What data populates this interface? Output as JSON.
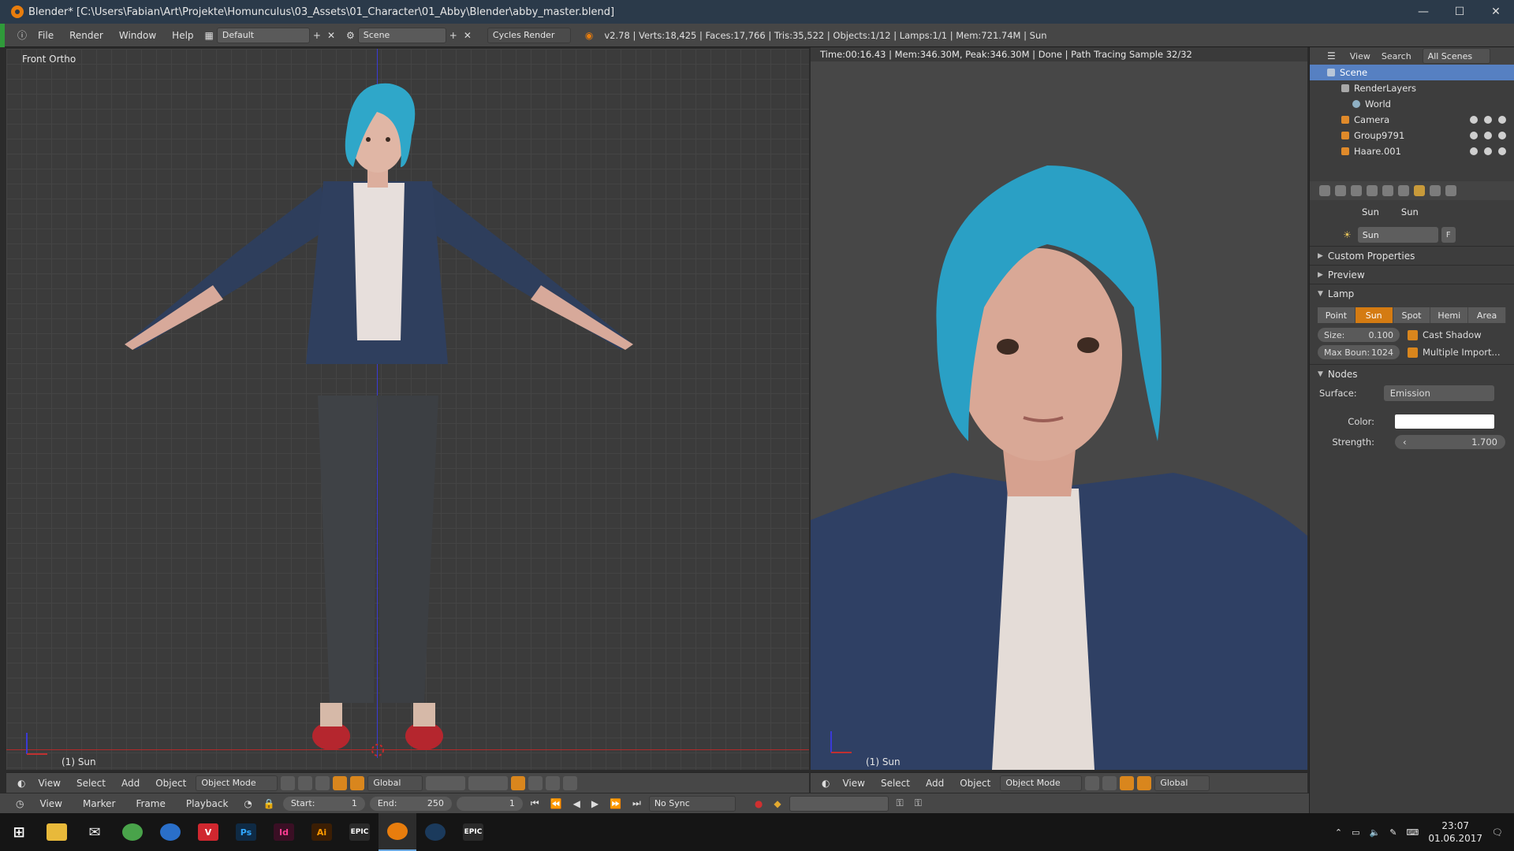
{
  "window": {
    "title": "Blender* [C:\\Users\\Fabian\\Art\\Projekte\\Homunculus\\03_Assets\\01_Character\\01_Abby\\Blender\\abby_master.blend]",
    "minimize": "—",
    "maximize": "☐",
    "close": "✕"
  },
  "infobar": {
    "menus": [
      "File",
      "Render",
      "Window",
      "Help"
    ],
    "layout": "Default",
    "scene": "Scene",
    "engine": "Cycles Render",
    "stats": "v2.78 | Verts:18,425 | Faces:17,766 | Tris:35,522 | Objects:1/12 | Lamps:1/1 | Mem:721.74M | Sun"
  },
  "viewport_left": {
    "view_label": "Front Ortho",
    "object_label": "(1) Sun",
    "header": {
      "menus": [
        "View",
        "Select",
        "Add",
        "Object"
      ],
      "mode": "Object Mode",
      "orientation": "Global"
    }
  },
  "viewport_right": {
    "render_status": "Time:00:16.43 | Mem:346.30M, Peak:346.30M | Done | Path Tracing Sample 32/32",
    "object_label": "(1) Sun",
    "header": {
      "menus": [
        "View",
        "Select",
        "Add",
        "Object"
      ],
      "mode": "Object Mode",
      "orientation": "Global"
    }
  },
  "timeline": {
    "menus": [
      "View",
      "Marker",
      "Frame",
      "Playback"
    ],
    "start_label": "Start:",
    "start": "1",
    "end_label": "End:",
    "end": "250",
    "current": "1",
    "sync": "No Sync"
  },
  "outliner": {
    "header": [
      "View",
      "Search",
      "All Scenes"
    ],
    "rows": [
      {
        "label": "Scene",
        "selected": true
      },
      {
        "label": "RenderLayers",
        "selected": false
      },
      {
        "label": "World",
        "selected": false
      },
      {
        "label": "Camera",
        "selected": false
      },
      {
        "label": "Group9791",
        "selected": false
      },
      {
        "label": "Haare.001",
        "selected": false
      }
    ]
  },
  "properties": {
    "breadcrumb": [
      "Sun",
      "Sun"
    ],
    "name": "Sun",
    "fake_user": "F",
    "panels": {
      "custom_properties": "Custom Properties",
      "preview": "Preview",
      "lamp": "Lamp",
      "nodes": "Nodes"
    },
    "lamp_types": [
      "Point",
      "Sun",
      "Spot",
      "Hemi",
      "Area"
    ],
    "lamp_type_active": "Sun",
    "size_label": "Size:",
    "size": "0.100",
    "max_bounces_label": "Max Boun:",
    "max_bounces": "1024",
    "cast_shadow": "Cast Shadow",
    "multiple_importance": "Multiple Import...",
    "surface_label": "Surface:",
    "surface": "Emission",
    "color_label": "Color:",
    "color": "#ffffff",
    "strength_label": "Strength:",
    "strength": "1.700"
  },
  "taskbar": {
    "apps": [
      "windows-start",
      "file-explorer",
      "mail",
      "browser",
      "firefox",
      "vivaldi",
      "photoshop",
      "indesign",
      "illustrator",
      "epic-games",
      "blender",
      "steam",
      "epic-launcher"
    ],
    "ps": "Ps",
    "id": "Id",
    "ai": "Ai",
    "epic1": "EPIC",
    "epic2": "EPIC",
    "time": "23:07",
    "date": "01.06.2017"
  },
  "colors": {
    "accent_orange": "#d47b12",
    "selection_blue": "#5680c2",
    "axis_red": "#b02a2a",
    "axis_blue": "#3a3ad6"
  }
}
